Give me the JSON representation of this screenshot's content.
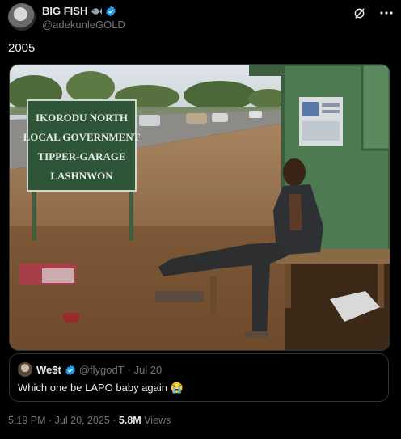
{
  "author": {
    "name": "BIG FISH",
    "handle": "@adekunleGOLD"
  },
  "tweet": {
    "text": "2005"
  },
  "image": {
    "sign_lines": [
      "IKORODU NORTH",
      "LOCAL GOVERNMENT",
      "TIPPER-GARAGE",
      "LASHNWON"
    ]
  },
  "quote": {
    "name": "We$t",
    "handle": "@flygodT",
    "date": "· Jul 20",
    "text": "Which one be LAPO baby again",
    "emoji": "😭"
  },
  "footer": {
    "time": "5:19 PM · Jul 20, 2025 · ",
    "views_count": "5.8M",
    "views_label": " Views"
  },
  "colors": {
    "background": "#000000",
    "text": "#e7e9ea",
    "muted": "#71767b",
    "verified": "#1d9bf0",
    "border": "#2f3336"
  },
  "icons": [
    "fish-emoji-icon",
    "verified-badge-icon",
    "grok-icon",
    "more-icon"
  ]
}
